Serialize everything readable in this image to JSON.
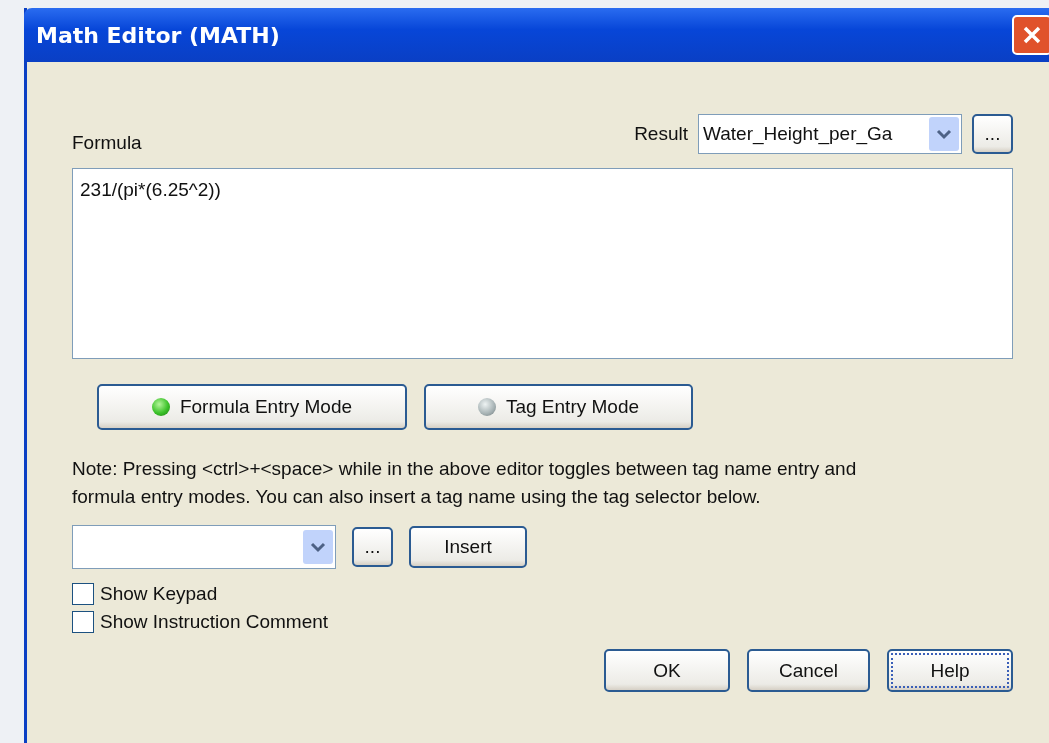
{
  "window": {
    "title": "Math Editor (MATH)"
  },
  "formula": {
    "label": "Formula",
    "value": "231/(pi*(6.25^2))"
  },
  "result": {
    "label": "Result",
    "value": "Water_Height_per_Ga",
    "browse": "..."
  },
  "modes": [
    {
      "label": "Formula Entry Mode",
      "on": true
    },
    {
      "label": "Tag Entry Mode",
      "on": false
    }
  ],
  "note": "Note: Pressing <ctrl>+<space> while in the above editor toggles between tag name entry and formula entry modes. You can also insert a tag name using the tag selector below.",
  "tag_selector": {
    "browse": "...",
    "insert": "Insert"
  },
  "checkboxes": [
    {
      "label": "Show Keypad",
      "checked": false
    },
    {
      "label": "Show Instruction Comment",
      "checked": false
    }
  ],
  "buttons": [
    {
      "label": "OK",
      "focused": false
    },
    {
      "label": "Cancel",
      "focused": false
    },
    {
      "label": "Help",
      "focused": true
    }
  ]
}
